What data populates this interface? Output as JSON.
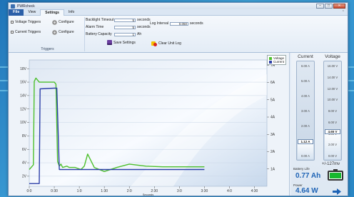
{
  "app": {
    "title": "PWRcheck"
  },
  "menu": {
    "file": "File",
    "tabs": [
      "View",
      "Settings",
      "Info"
    ],
    "active_tab": "Settings"
  },
  "triggers": {
    "items": [
      {
        "label": "Voltage Triggers",
        "configure": "Configure"
      },
      {
        "label": "Current Triggers",
        "configure": "Configure"
      }
    ],
    "caption": "Triggers"
  },
  "settings": {
    "backlight": {
      "label": "Backlight Timeout",
      "value": "5",
      "unit": "seconds"
    },
    "alarm": {
      "label": "Alarm Time",
      "value": "5",
      "unit": "seconds"
    },
    "battery": {
      "label": "Battery Capacity",
      "value": "1",
      "unit": "Ah"
    },
    "log_interval": {
      "label": "Log Interval",
      "value": "0.050",
      "unit": "seconds"
    },
    "save_label": "Save Settings",
    "clear_label": "Clear Unit Log"
  },
  "chart_data": {
    "type": "line",
    "x_ticks": [
      "0:0",
      "0:30",
      "1:0",
      "1:30",
      "2:0",
      "2:30",
      "3:0",
      "3:30",
      "4:0",
      "4:30"
    ],
    "x_label": "Seconds",
    "y_left_ticks": [
      "2V",
      "4V",
      "6V",
      "8V",
      "10V",
      "12V",
      "14V",
      "16V",
      "18V"
    ],
    "y_right_ticks": [
      "1A",
      "2A",
      "3A",
      "4A",
      "5A",
      "6A",
      "7A"
    ],
    "xlim": [
      0,
      285
    ],
    "ylim_left": [
      0.5,
      19.3
    ],
    "series": [
      {
        "name": "Voltage",
        "color": "#4cbf2c",
        "x": [
          0,
          5,
          6,
          8,
          12,
          30,
          32,
          34,
          36,
          38,
          40,
          45,
          48,
          52,
          55,
          62,
          66,
          70,
          78,
          90,
          105,
          120,
          140,
          160,
          180,
          210
        ],
        "y": [
          3.0,
          3.7,
          16.1,
          16.6,
          16.0,
          16.0,
          15.7,
          4.2,
          3.5,
          3.8,
          3.3,
          3.5,
          3.3,
          3.3,
          3.3,
          3.0,
          3.5,
          5.3,
          3.3,
          2.7,
          3.3,
          3.8,
          3.5,
          3.4,
          3.4,
          3.4
        ]
      },
      {
        "name": "Current",
        "color": "#2d3fa8",
        "x": [
          0,
          12,
          13,
          30,
          33,
          36,
          60,
          90,
          120,
          150,
          180,
          210
        ],
        "y": [
          0.9,
          0.9,
          15.0,
          15.1,
          15.1,
          3.0,
          3.0,
          3.0,
          3.0,
          3.0,
          3.0,
          3.0
        ]
      }
    ],
    "legend_position": "top-right",
    "grid": true
  },
  "side": {
    "current": {
      "title": "Current",
      "ticks": [
        "6.00 A",
        "5.00 A",
        "4.00 A",
        "3.00 A",
        "2.00 A",
        "1.00 A",
        "0.00 A"
      ],
      "reading": "1.12 A",
      "fraction": 0.187
    },
    "voltage": {
      "title": "Voltage",
      "ticks": [
        "16.00 V",
        "14.00 V",
        "12.00 V",
        "10.00 V",
        "8.00 V",
        "6.00 V",
        "4.00 V",
        "2.00 V",
        "0.00 V"
      ],
      "reading": "4.65 V",
      "fraction": 0.29
    },
    "mv_reading": "+/-127mv",
    "battery_life_label": "Battery Life",
    "battery_life_value": "0.77 Ah",
    "power_label": "Power",
    "power_value": "4.64 W"
  }
}
